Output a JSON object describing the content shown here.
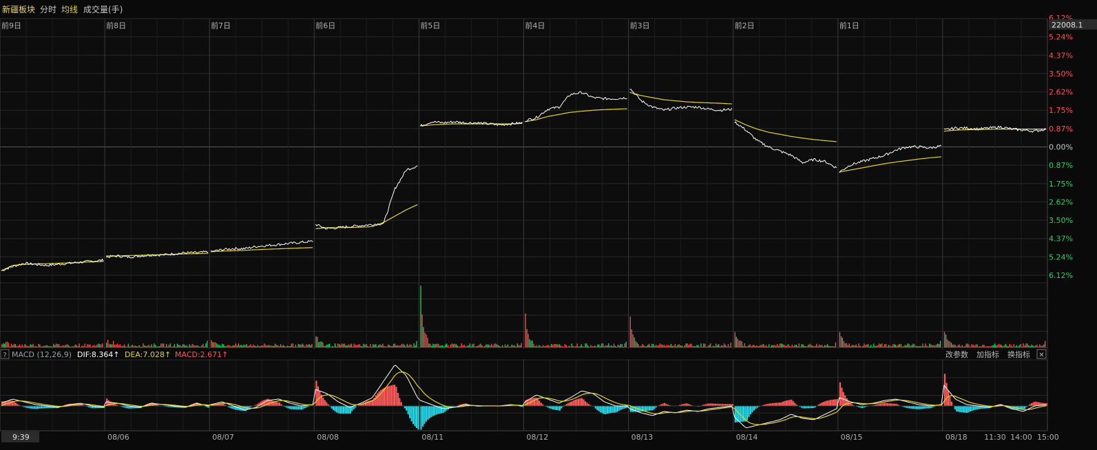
{
  "toolbar": {
    "title": "新疆板块",
    "tab_intraday": "分时",
    "tab_avg": "均线",
    "tab_volume": "成交量(手)"
  },
  "colors": {
    "price_line": "#ffffff",
    "avg_line": "#e6d42a",
    "up": "#ff5252",
    "down": "#2ecf6a",
    "macd_up": "#ff5a5a",
    "macd_down": "#22d8e6",
    "grid": "#2a2a2a",
    "grid_strong": "#3a3a3a",
    "dif": "#ffffff",
    "dea": "#e6d42a"
  },
  "day_labels": [
    "前9日",
    "前8日",
    "前7日",
    "前6日",
    "前5日",
    "前4日",
    "前3日",
    "前2日",
    "前1日"
  ],
  "date_axis": {
    "start_time": "9:39",
    "dates": [
      "08/06",
      "08/07",
      "08/08",
      "08/11",
      "08/12",
      "08/13",
      "08/14",
      "08/15",
      "08/18"
    ],
    "times": [
      "11:30",
      "14:00",
      "15:00"
    ]
  },
  "price_readout": "22008.1",
  "top_partial": "6.12%",
  "chart_data": {
    "type": "line",
    "days": 10,
    "ylim_pct": [
      -6.12,
      6.12
    ],
    "y_ticks_up": [
      "5.24%",
      "4.37%",
      "3.50%",
      "2.62%",
      "1.75%",
      "0.87%"
    ],
    "y_tick_zero": "0.00%",
    "y_ticks_down": [
      "0.87%",
      "1.75%",
      "2.62%",
      "3.50%",
      "4.37%",
      "5.24%",
      "6.12%"
    ],
    "price_series_pct": [
      [
        -5.9,
        -5.7,
        -5.55,
        -5.6,
        -5.65,
        -5.6,
        -5.55,
        -5.5,
        -5.45,
        -5.4
      ],
      [
        -5.25,
        -5.2,
        -5.25,
        -5.2,
        -5.15,
        -5.15,
        -5.1,
        -5.05,
        -5.05,
        -5.0
      ],
      [
        -5.0,
        -4.9,
        -4.85,
        -4.85,
        -4.75,
        -4.7,
        -4.65,
        -4.6,
        -4.55,
        -4.5
      ],
      [
        -3.7,
        -3.9,
        -3.85,
        -3.8,
        -3.75,
        -3.7,
        -3.65,
        -2.0,
        -1.1,
        -0.9
      ],
      [
        1.0,
        1.2,
        1.15,
        1.2,
        1.15,
        1.15,
        1.1,
        1.05,
        1.1,
        1.15
      ],
      [
        1.25,
        1.4,
        1.8,
        1.9,
        2.5,
        2.6,
        2.35,
        2.3,
        2.3,
        2.35
      ],
      [
        2.8,
        2.2,
        1.9,
        1.75,
        1.85,
        1.9,
        1.9,
        1.8,
        1.75,
        1.8
      ],
      [
        1.2,
        0.8,
        0.3,
        0.0,
        -0.2,
        -0.4,
        -0.75,
        -0.6,
        -0.7,
        -1.0
      ],
      [
        -1.2,
        -0.85,
        -0.7,
        -0.55,
        -0.4,
        -0.15,
        0.0,
        0.0,
        -0.05,
        0.05
      ],
      [
        0.8,
        0.9,
        0.9,
        0.85,
        0.9,
        0.95,
        0.85,
        0.8,
        0.75,
        0.85
      ]
    ],
    "avg_series_pct": [
      [
        -5.9,
        -5.65,
        -5.6,
        -5.58,
        -5.57,
        -5.55,
        -5.53,
        -5.5,
        -5.48,
        -5.46
      ],
      [
        -5.2,
        -5.2,
        -5.18,
        -5.17,
        -5.15,
        -5.14,
        -5.12,
        -5.1,
        -5.09,
        -5.07
      ],
      [
        -5.0,
        -4.97,
        -4.95,
        -4.93,
        -4.9,
        -4.88,
        -4.86,
        -4.84,
        -4.82,
        -4.8
      ],
      [
        -3.9,
        -3.85,
        -3.85,
        -3.84,
        -3.83,
        -3.8,
        -3.6,
        -3.3,
        -3.0,
        -2.75
      ],
      [
        1.0,
        1.05,
        1.08,
        1.1,
        1.1,
        1.1,
        1.1,
        1.1,
        1.1,
        1.12
      ],
      [
        1.2,
        1.3,
        1.45,
        1.55,
        1.65,
        1.7,
        1.75,
        1.78,
        1.8,
        1.82
      ],
      [
        2.6,
        2.45,
        2.35,
        2.25,
        2.2,
        2.15,
        2.12,
        2.1,
        2.08,
        2.05
      ],
      [
        1.3,
        1.05,
        0.85,
        0.7,
        0.6,
        0.5,
        0.42,
        0.35,
        0.3,
        0.25
      ],
      [
        -1.2,
        -1.1,
        -1.0,
        -0.9,
        -0.8,
        -0.72,
        -0.65,
        -0.58,
        -0.52,
        -0.47
      ],
      [
        0.75,
        0.8,
        0.82,
        0.83,
        0.84,
        0.85,
        0.85,
        0.85,
        0.85,
        0.85
      ]
    ],
    "volume_spikes": [
      0.05,
      0.08,
      0.12,
      0.18,
      1.0,
      0.55,
      0.5,
      0.25,
      0.25,
      0.25
    ],
    "macd": {
      "label": "MACD (12,26,9)",
      "dif_label": "DIF:8.364",
      "dea_label": "DEA:7.028",
      "macd_label": "MACD:2.671",
      "arrow": "↑",
      "help": "?",
      "btn_params": "改参数",
      "btn_add": "加指标",
      "btn_switch": "换指标",
      "btn_close": "✕",
      "dif_series": [
        [
          0.2,
          0.5,
          0.3,
          0.1,
          0.0,
          -0.1,
          0.1,
          0.2,
          0.0,
          -0.1
        ],
        [
          0.3,
          0.2,
          0.0,
          -0.1,
          0.2,
          0.1,
          0.0,
          -0.1,
          0.2,
          0.0
        ],
        [
          0.1,
          0.3,
          0.0,
          -0.3,
          -0.1,
          0.4,
          0.5,
          0.2,
          0.0,
          0.1
        ],
        [
          1.2,
          0.9,
          0.3,
          -0.1,
          0.2,
          0.6,
          1.8,
          3.0,
          2.2,
          0.6
        ],
        [
          0.4,
          0.1,
          -0.2,
          -0.1,
          0.1,
          0.0,
          0.0,
          0.0,
          0.1,
          0.0
        ],
        [
          0.3,
          0.8,
          0.5,
          0.2,
          0.6,
          1.1,
          0.9,
          0.3,
          0.0,
          0.0
        ],
        [
          -0.2,
          -0.5,
          -0.7,
          -0.4,
          -0.5,
          -0.3,
          -0.4,
          -0.2,
          -0.1,
          0.0
        ],
        [
          -0.8,
          -1.6,
          -1.4,
          -1.2,
          -1.0,
          -0.6,
          -0.9,
          -1.0,
          -0.6,
          -0.2
        ],
        [
          0.6,
          0.3,
          0.1,
          0.2,
          0.4,
          0.5,
          0.3,
          0.1,
          0.0,
          0.1
        ],
        [
          1.5,
          0.5,
          0.1,
          0.0,
          -0.1,
          0.1,
          -0.2,
          -0.4,
          0.0,
          0.1
        ]
      ]
    }
  }
}
